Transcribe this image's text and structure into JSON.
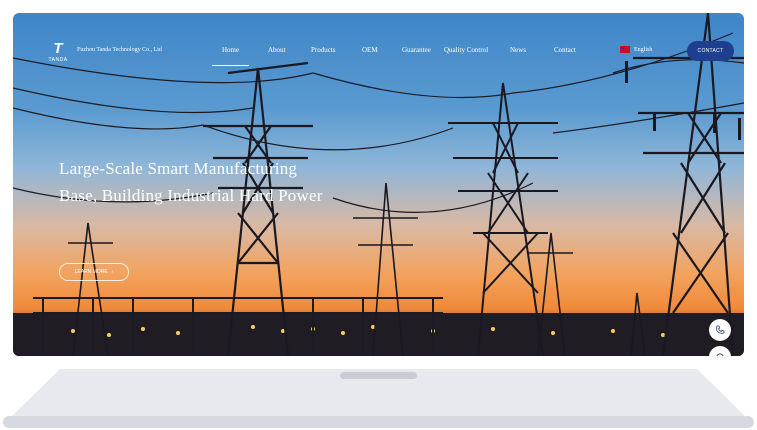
{
  "header": {
    "logo_mark": "T",
    "logo_word": "TANDA",
    "company_name": "Fuzhou Tanda Technology Co., Ltd",
    "nav": [
      {
        "label": "Home",
        "active": true
      },
      {
        "label": "About"
      },
      {
        "label": "Products"
      },
      {
        "label": "OEM"
      },
      {
        "label": "Guarantee"
      },
      {
        "label": "Quality Control"
      },
      {
        "label": "News"
      },
      {
        "label": "Contact"
      }
    ],
    "language": "English",
    "contact_button": "CONTACT"
  },
  "hero": {
    "title": "Large-Scale Smart Manufacturing Base, Building Industrial Hard Power",
    "button": "LEARN MORE"
  },
  "floating": {
    "icons": [
      "phone-icon",
      "chat-icon"
    ]
  },
  "colors": {
    "contact_bg": "#1e3f8f",
    "sky_top": "#3e86c9",
    "sunset": "#f08a3a"
  }
}
